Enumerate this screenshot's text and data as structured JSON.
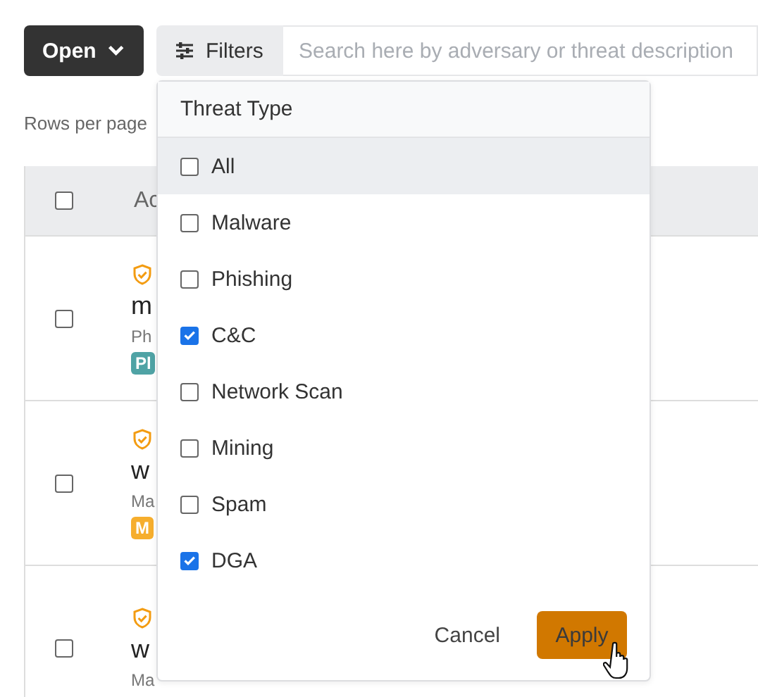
{
  "toolbar": {
    "open_button": "Open",
    "filters_button": "Filters",
    "search": {
      "placeholder": "Search here by adversary or threat description"
    }
  },
  "rows_per_page": "Rows per page",
  "table": {
    "header": {
      "checked": false,
      "column_2": "Ac"
    },
    "rows": [
      {
        "checked": false,
        "title": "m",
        "subtitle": "Ph",
        "badge": {
          "text": "Pl",
          "color": "#4fa3a5"
        }
      },
      {
        "checked": false,
        "title": "w",
        "subtitle": "Ma",
        "badge": {
          "text": "M",
          "color": "#f6ae2d"
        }
      },
      {
        "checked": false,
        "title": "w",
        "subtitle": "Ma"
      }
    ]
  },
  "filter_menu": {
    "title": "Threat Type",
    "options": [
      {
        "label": "All",
        "checked": false,
        "hovered": true
      },
      {
        "label": "Malware",
        "checked": false,
        "hovered": false
      },
      {
        "label": "Phishing",
        "checked": false,
        "hovered": false
      },
      {
        "label": "C&C",
        "checked": true,
        "hovered": false
      },
      {
        "label": "Network Scan",
        "checked": false,
        "hovered": false
      },
      {
        "label": "Mining",
        "checked": false,
        "hovered": false
      },
      {
        "label": "Spam",
        "checked": false,
        "hovered": false
      },
      {
        "label": "DGA",
        "checked": true,
        "hovered": false
      }
    ],
    "cancel": "Cancel",
    "apply": "Apply"
  }
}
